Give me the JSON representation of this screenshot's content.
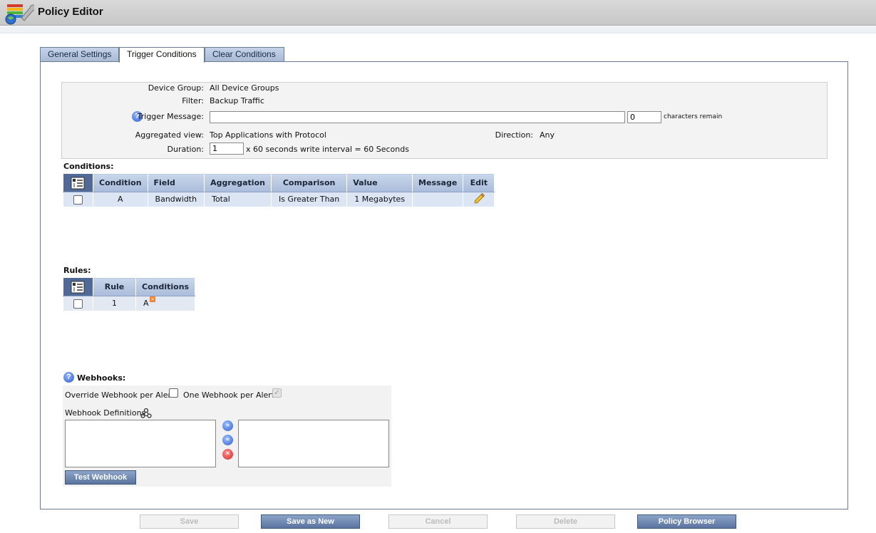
{
  "window": {
    "title": "Policy Editor",
    "icon": "policy-editor-app-icon"
  },
  "tabs": [
    {
      "label": "General Settings",
      "active": false
    },
    {
      "label": "Trigger Conditions",
      "active": true
    },
    {
      "label": "Clear Conditions",
      "active": false
    }
  ],
  "info": {
    "device_group_label": "Device Group:",
    "device_group_value": "All Device Groups",
    "filter_label": "Filter:",
    "filter_value": "Backup Traffic",
    "trigger_message_label": "Trigger Message:",
    "trigger_message_value": "",
    "char_count_value": "0",
    "characters_remain": "characters remain",
    "aggregated_view_label": "Aggregated view:",
    "aggregated_view_value": "Top Applications with Protocol",
    "direction_label": "Direction:",
    "direction_value": "Any",
    "duration_label": "Duration:",
    "duration_value": "1",
    "duration_suffix": "x 60 seconds write interval = 60 Seconds"
  },
  "conditions": {
    "title": "Conditions:",
    "headers": [
      "Condition",
      "Field",
      "Aggregation",
      "Comparison",
      "Value",
      "Message",
      "Edit"
    ],
    "rows": [
      {
        "condition": "A",
        "field": "Bandwidth",
        "aggregation": "Total",
        "comparison": "Is Greater Than",
        "value": "1 Megabytes",
        "message": "",
        "edit_icon": "pencil-icon"
      }
    ]
  },
  "rules": {
    "title": "Rules:",
    "headers": [
      "Rule",
      "Conditions"
    ],
    "rows": [
      {
        "rule": "1",
        "conditions": "A"
      }
    ]
  },
  "webhooks": {
    "title": "Webhooks:",
    "override_label": "Override Webhook per Alert:",
    "override_checked": false,
    "one_per_alert_label": "One Webhook per Alert:",
    "one_per_alert_checked": true,
    "definitions_label": "Webhook Definitions",
    "test_button": "Test Webhook"
  },
  "footer": {
    "save": "Save",
    "save_as_new": "Save as New",
    "cancel": "Cancel",
    "delete": "Delete",
    "policy_browser": "Policy Browser"
  },
  "colors": {
    "tab_bg": "#a8b9d6",
    "header_bg": "#b6c6e0",
    "row_bg": "#dbe5f4",
    "button_blue": "#5a749f"
  }
}
